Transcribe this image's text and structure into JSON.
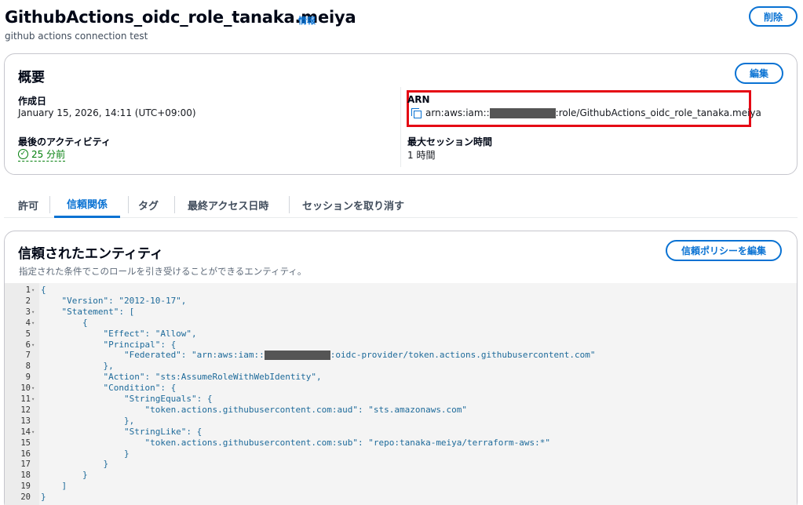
{
  "header": {
    "title": "GithubActions_oidc_role_tanaka.meiya",
    "info_link": "情報",
    "subtitle": "github actions connection test",
    "delete_label": "削除"
  },
  "summary": {
    "title": "概要",
    "edit_label": "編集",
    "created_label": "作成日",
    "created_value": "January 15, 2026, 14:11 (UTC+09:00)",
    "last_activity_label": "最後のアクティビティ",
    "last_activity_value": "25 分前",
    "arn_label": "ARN",
    "arn_prefix": "arn:aws:iam::",
    "arn_suffix": ":role/GithubActions_oidc_role_tanaka.meiya",
    "max_session_label": "最大セッション時間",
    "max_session_value": "1 時間"
  },
  "tabs": [
    {
      "label": "許可",
      "active": false
    },
    {
      "label": "信頼関係",
      "active": true
    },
    {
      "label": "タグ",
      "active": false
    },
    {
      "label": "最終アクセス日時",
      "active": false
    },
    {
      "label": "セッションを取り消す",
      "active": false
    }
  ],
  "trust": {
    "title": "信頼されたエンティティ",
    "description": "指定された条件でこのロールを引き受けることができるエンティティ。",
    "edit_policy_label": "信頼ポリシーを編集",
    "lines": [
      {
        "n": "1",
        "fold": true,
        "text": "{"
      },
      {
        "n": "2",
        "fold": false,
        "text": "    \"Version\": \"2012-10-17\","
      },
      {
        "n": "3",
        "fold": true,
        "text": "    \"Statement\": ["
      },
      {
        "n": "4",
        "fold": true,
        "text": "        {"
      },
      {
        "n": "5",
        "fold": false,
        "text": "            \"Effect\": \"Allow\","
      },
      {
        "n": "6",
        "fold": true,
        "text": "            \"Principal\": {"
      },
      {
        "n": "7",
        "fold": false,
        "text": "                \"Federated\": \"arn:aws:iam::",
        "redacted": true,
        "after": ":oidc-provider/token.actions.githubusercontent.com\""
      },
      {
        "n": "8",
        "fold": false,
        "text": "            },"
      },
      {
        "n": "9",
        "fold": false,
        "text": "            \"Action\": \"sts:AssumeRoleWithWebIdentity\","
      },
      {
        "n": "10",
        "fold": true,
        "text": "            \"Condition\": {"
      },
      {
        "n": "11",
        "fold": true,
        "text": "                \"StringEquals\": {"
      },
      {
        "n": "12",
        "fold": false,
        "text": "                    \"token.actions.githubusercontent.com:aud\": \"sts.amazonaws.com\""
      },
      {
        "n": "13",
        "fold": false,
        "text": "                },"
      },
      {
        "n": "14",
        "fold": true,
        "text": "                \"StringLike\": {"
      },
      {
        "n": "15",
        "fold": false,
        "text": "                    \"token.actions.githubusercontent.com:sub\": \"repo:tanaka-meiya/terraform-aws:*\""
      },
      {
        "n": "16",
        "fold": false,
        "text": "                }"
      },
      {
        "n": "17",
        "fold": false,
        "text": "            }"
      },
      {
        "n": "18",
        "fold": false,
        "text": "        }"
      },
      {
        "n": "19",
        "fold": false,
        "text": "    ]"
      },
      {
        "n": "20",
        "fold": false,
        "text": "}"
      }
    ]
  },
  "colors": {
    "accent": "#0972d3",
    "success": "#037f0c",
    "highlight": "#e50914"
  }
}
